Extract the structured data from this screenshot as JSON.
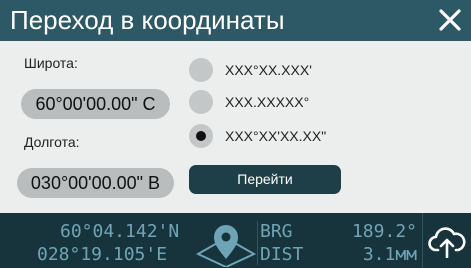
{
  "dialog": {
    "title": "Переход в координаты",
    "close_label": "X",
    "latitude_label": "Широта:",
    "latitude_value": "60°00'00.00\" С",
    "longitude_label": "Долгота:",
    "longitude_value": "030°00'00.00\" В",
    "formats": [
      {
        "label": "XXX°XX.XXX'",
        "selected": false
      },
      {
        "label": "XXX.XXXXX°",
        "selected": false
      },
      {
        "label": "XXX°XX'XX.XX\"",
        "selected": true
      }
    ],
    "go_button": "Перейти"
  },
  "status": {
    "lat": "60°04.142'N",
    "lon": "028°19.105'E",
    "brg_label": "BRG",
    "brg_value": "189.2°",
    "dist_label": "DIST",
    "dist_value": "3.1мм"
  },
  "icons": {
    "close": "close-icon",
    "location": "location-pin-icon",
    "upload": "cloud-upload-icon"
  },
  "colors": {
    "title_bar": "#2d5866",
    "panel": "#eceeee",
    "pill": "#b9bdbd",
    "go_button": "#1f3f48",
    "status_bar": "#17343d",
    "status_text": "#6fa4b6"
  }
}
